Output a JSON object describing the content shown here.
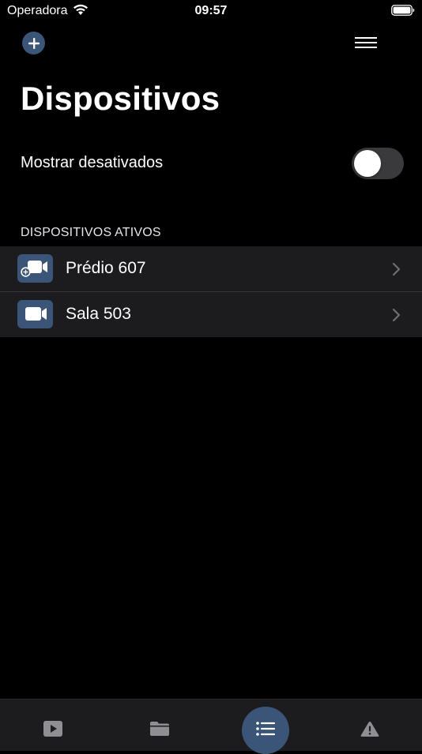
{
  "status_bar": {
    "carrier": "Operadora",
    "time": "09:57",
    "icons": [
      "wifi-icon",
      "battery-icon"
    ]
  },
  "header": {
    "add_icon": "plus-icon",
    "menu_icon": "hamburger-icon",
    "title": "Dispositivos"
  },
  "filter": {
    "label": "Mostrar desativados",
    "enabled": false
  },
  "section": {
    "title": "DISPOSITIVOS ATIVOS"
  },
  "devices": [
    {
      "name": "Prédio 607",
      "icon": "video-camera-add-icon"
    },
    {
      "name": "Sala 503",
      "icon": "video-camera-icon"
    }
  ],
  "tab_bar": {
    "tabs": [
      {
        "id": "video",
        "icon": "play-icon",
        "selected": false
      },
      {
        "id": "folder",
        "icon": "folder-icon",
        "selected": false
      },
      {
        "id": "list",
        "icon": "list-icon",
        "selected": true
      },
      {
        "id": "alert",
        "icon": "warning-icon",
        "selected": false
      }
    ]
  },
  "colors": {
    "background": "#000000",
    "surface": "#1c1c1e",
    "accent": "#3a5577",
    "toggle_off": "#3a3a3c",
    "separator": "#38383a"
  }
}
